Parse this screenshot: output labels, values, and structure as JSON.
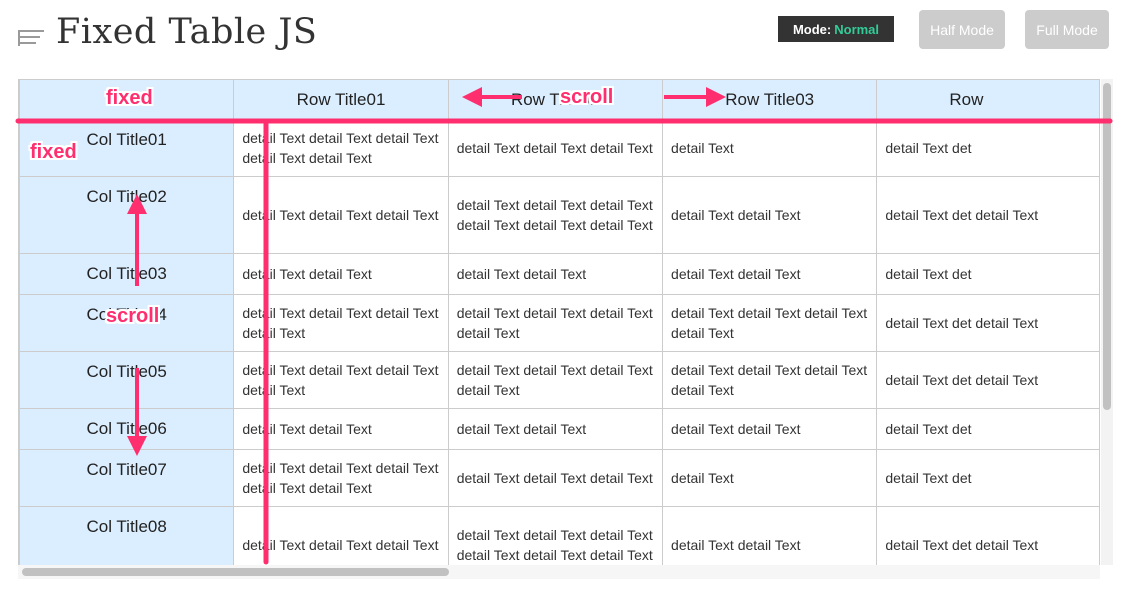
{
  "header": {
    "title": "Fixed Table JS",
    "mode_label": "Mode:",
    "mode_value": "Normal",
    "half_mode_label": "Half Mode",
    "full_mode_label": "Full Mode"
  },
  "table": {
    "columns": [
      "",
      "Row Title01",
      "Row Title02",
      "Row Title03",
      "Row"
    ],
    "rows": [
      {
        "title": "Col Title01",
        "cells": [
          "detail Text detail Text detail Text detail Text detail Text",
          "detail Text detail Text detail Text",
          "detail Text",
          "detail Text det"
        ]
      },
      {
        "title": "Col Title02",
        "cells": [
          "detail Text detail Text detail Text",
          "detail Text detail Text detail Text detail Text detail Text detail Text",
          "detail Text detail Text",
          "detail Text det detail Text"
        ]
      },
      {
        "title": "Col Title03",
        "cells": [
          "detail Text detail Text",
          "detail Text detail Text",
          "detail Text detail Text",
          "detail Text det"
        ]
      },
      {
        "title": "Col Title04",
        "cells": [
          "detail Text detail Text detail Text detail Text",
          "detail Text detail Text detail Text detail Text",
          "detail Text detail Text detail Text detail Text",
          "detail Text det detail Text"
        ]
      },
      {
        "title": "Col Title05",
        "cells": [
          "detail Text detail Text detail Text detail Text",
          "detail Text detail Text detail Text detail Text",
          "detail Text detail Text detail Text detail Text",
          "detail Text det detail Text"
        ]
      },
      {
        "title": "Col Title06",
        "cells": [
          "detail Text detail Text",
          "detail Text detail Text",
          "detail Text detail Text",
          "detail Text det"
        ]
      },
      {
        "title": "Col Title07",
        "cells": [
          "detail Text detail Text detail Text detail Text detail Text",
          "detail Text detail Text detail Text",
          "detail Text",
          "detail Text det"
        ]
      },
      {
        "title": "Col Title08",
        "cells": [
          "detail Text detail Text detail Text",
          "detail Text detail Text detail Text detail Text detail Text detail Text",
          "detail Text detail Text",
          "detail Text det detail Text"
        ]
      }
    ]
  },
  "annotations": {
    "fixed_header": "fixed",
    "fixed_column": "fixed",
    "scroll_horizontal": "scroll",
    "scroll_vertical": "scroll",
    "color": "#ff2e6e"
  },
  "icons": {
    "menu": "list-lines-icon"
  },
  "colors": {
    "header_bg": "#dbeeff",
    "mode_badge_bg": "#333333",
    "mode_value": "#33cc99",
    "button_bg": "#cccccc",
    "grid_line": "#cccccc"
  }
}
